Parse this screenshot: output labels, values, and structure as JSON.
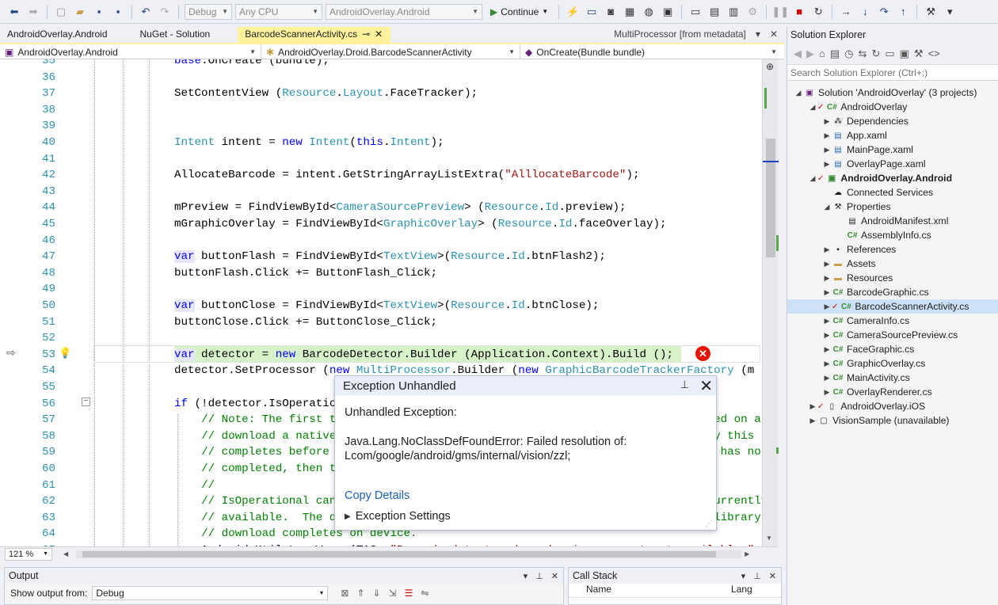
{
  "toolbar": {
    "config": "Debug",
    "platform": "Any CPU",
    "startup": "AndroidOverlay.Android",
    "continue_label": "Continue"
  },
  "tabs": {
    "items": [
      {
        "label": "AndroidOverlay.Android"
      },
      {
        "label": "NuGet - Solution"
      }
    ],
    "active": "BarcodeScannerActivity.cs",
    "right": "MultiProcessor [from metadata]"
  },
  "nav": {
    "project": "AndroidOverlay.Android",
    "type": "AndroidOverlay.Droid.BarcodeScannerActivity",
    "member": "OnCreate(Bundle bundle)"
  },
  "editor": {
    "zoom": "121 %"
  },
  "code_lines": [
    {
      "n": "35",
      "t": "base.OnCreate (bundle);"
    },
    {
      "n": "36",
      "t": ""
    },
    {
      "n": "37",
      "t": "SetContentView (Resource.Layout.FaceTracker);"
    },
    {
      "n": "38",
      "t": ""
    },
    {
      "n": "39",
      "t": ""
    },
    {
      "n": "40",
      "t": "Intent intent = new Intent(this.Intent);"
    },
    {
      "n": "41",
      "t": ""
    },
    {
      "n": "42",
      "t": "AllocateBarcode = intent.GetStringArrayListExtra(\"AlllocateBarcode\");"
    },
    {
      "n": "43",
      "t": ""
    },
    {
      "n": "44",
      "t": "mPreview = FindViewById<CameraSourcePreview> (Resource.Id.preview);"
    },
    {
      "n": "45",
      "t": "mGraphicOverlay = FindViewById<GraphicOverlay> (Resource.Id.faceOverlay);"
    },
    {
      "n": "46",
      "t": ""
    },
    {
      "n": "47",
      "t": "var buttonFlash = FindViewById<TextView>(Resource.Id.btnFlash2);"
    },
    {
      "n": "48",
      "t": "buttonFlash.Click += ButtonFlash_Click;"
    },
    {
      "n": "49",
      "t": ""
    },
    {
      "n": "50",
      "t": "var buttonClose = FindViewById<TextView>(Resource.Id.btnClose);"
    },
    {
      "n": "51",
      "t": "buttonClose.Click += ButtonClose_Click;"
    },
    {
      "n": "52",
      "t": ""
    },
    {
      "n": "53",
      "t": "var detector = new BarcodeDetector.Builder (Application.Context).Build ();"
    },
    {
      "n": "54",
      "t": "detector.SetProcessor (new MultiProcessor.Builder (new GraphicBarcodeTrackerFactory (m"
    },
    {
      "n": "55",
      "t": ""
    },
    {
      "n": "56",
      "t": "if (!detector.IsOperational) {"
    },
    {
      "n": "57",
      "t": "    // Note: The first time that an app using the barcode or face API is installed on a device, GMS will"
    },
    {
      "n": "58",
      "t": "    // download a native library to the device in order to do detection.  Usually this"
    },
    {
      "n": "59",
      "t": "    // completes before the app is run for the first time.  But if that download has not yet"
    },
    {
      "n": "60",
      "t": "    // completed, then the above call will not detect any barcodes and/or faces."
    },
    {
      "n": "61",
      "t": "    //"
    },
    {
      "n": "62",
      "t": "    // IsOperational can be used to check if the required native libraries are currently"
    },
    {
      "n": "63",
      "t": "    // available.  The detectors will automatically become operational once the library"
    },
    {
      "n": "64",
      "t": "    // download completes on device."
    },
    {
      "n": "65",
      "t": "    Android.Util.Log.Warn (TAG, \"Barcode detector dependencies are not yet available.\""
    }
  ],
  "exception": {
    "title": "Exception Unhandled",
    "subtitle": "Unhandled Exception:",
    "message": "Java.Lang.NoClassDefFoundError: Failed resolution of: Lcom/google/android/gms/internal/vision/zzl;",
    "copy_details": "Copy Details",
    "settings": "Exception Settings"
  },
  "solution_explorer": {
    "title": "Solution Explorer",
    "search_placeholder": "Search Solution Explorer (Ctrl+;)",
    "nodes": [
      {
        "label": "Solution 'AndroidOverlay' (3 projects)",
        "icon": "solution-icon"
      },
      {
        "label": "AndroidOverlay",
        "icon": "csharp-project-icon"
      },
      {
        "label": "Dependencies",
        "icon": "dependencies-icon"
      },
      {
        "label": "App.xaml",
        "icon": "xaml-file-icon"
      },
      {
        "label": "MainPage.xaml",
        "icon": "xaml-file-icon"
      },
      {
        "label": "OverlayPage.xaml",
        "icon": "xaml-file-icon"
      },
      {
        "label": "AndroidOverlay.Android",
        "icon": "android-project-icon"
      },
      {
        "label": "Connected Services",
        "icon": "connected-services-icon"
      },
      {
        "label": "Properties",
        "icon": "wrench-icon"
      },
      {
        "label": "AndroidManifest.xml",
        "icon": "xml-file-icon"
      },
      {
        "label": "AssemblyInfo.cs",
        "icon": "csharp-file-icon"
      },
      {
        "label": "References",
        "icon": "references-icon"
      },
      {
        "label": "Assets",
        "icon": "folder-icon"
      },
      {
        "label": "Resources",
        "icon": "folder-icon"
      },
      {
        "label": "BarcodeGraphic.cs",
        "icon": "csharp-file-icon"
      },
      {
        "label": "BarcodeScannerActivity.cs",
        "icon": "csharp-file-icon"
      },
      {
        "label": "CameraInfo.cs",
        "icon": "csharp-file-icon"
      },
      {
        "label": "CameraSourcePreview.cs",
        "icon": "csharp-file-icon"
      },
      {
        "label": "FaceGraphic.cs",
        "icon": "csharp-file-icon"
      },
      {
        "label": "GraphicOverlay.cs",
        "icon": "csharp-file-icon"
      },
      {
        "label": "MainActivity.cs",
        "icon": "csharp-file-icon"
      },
      {
        "label": "OverlayRenderer.cs",
        "icon": "csharp-file-icon"
      },
      {
        "label": "AndroidOverlay.iOS",
        "icon": "ios-project-icon"
      },
      {
        "label": "VisionSample (unavailable)",
        "icon": "unavailable-project-icon"
      }
    ]
  },
  "output": {
    "title": "Output",
    "show_from_label": "Show output from:",
    "show_from_value": "Debug"
  },
  "callstack": {
    "title": "Call Stack",
    "col_name": "Name",
    "col_lang": "Lang"
  }
}
